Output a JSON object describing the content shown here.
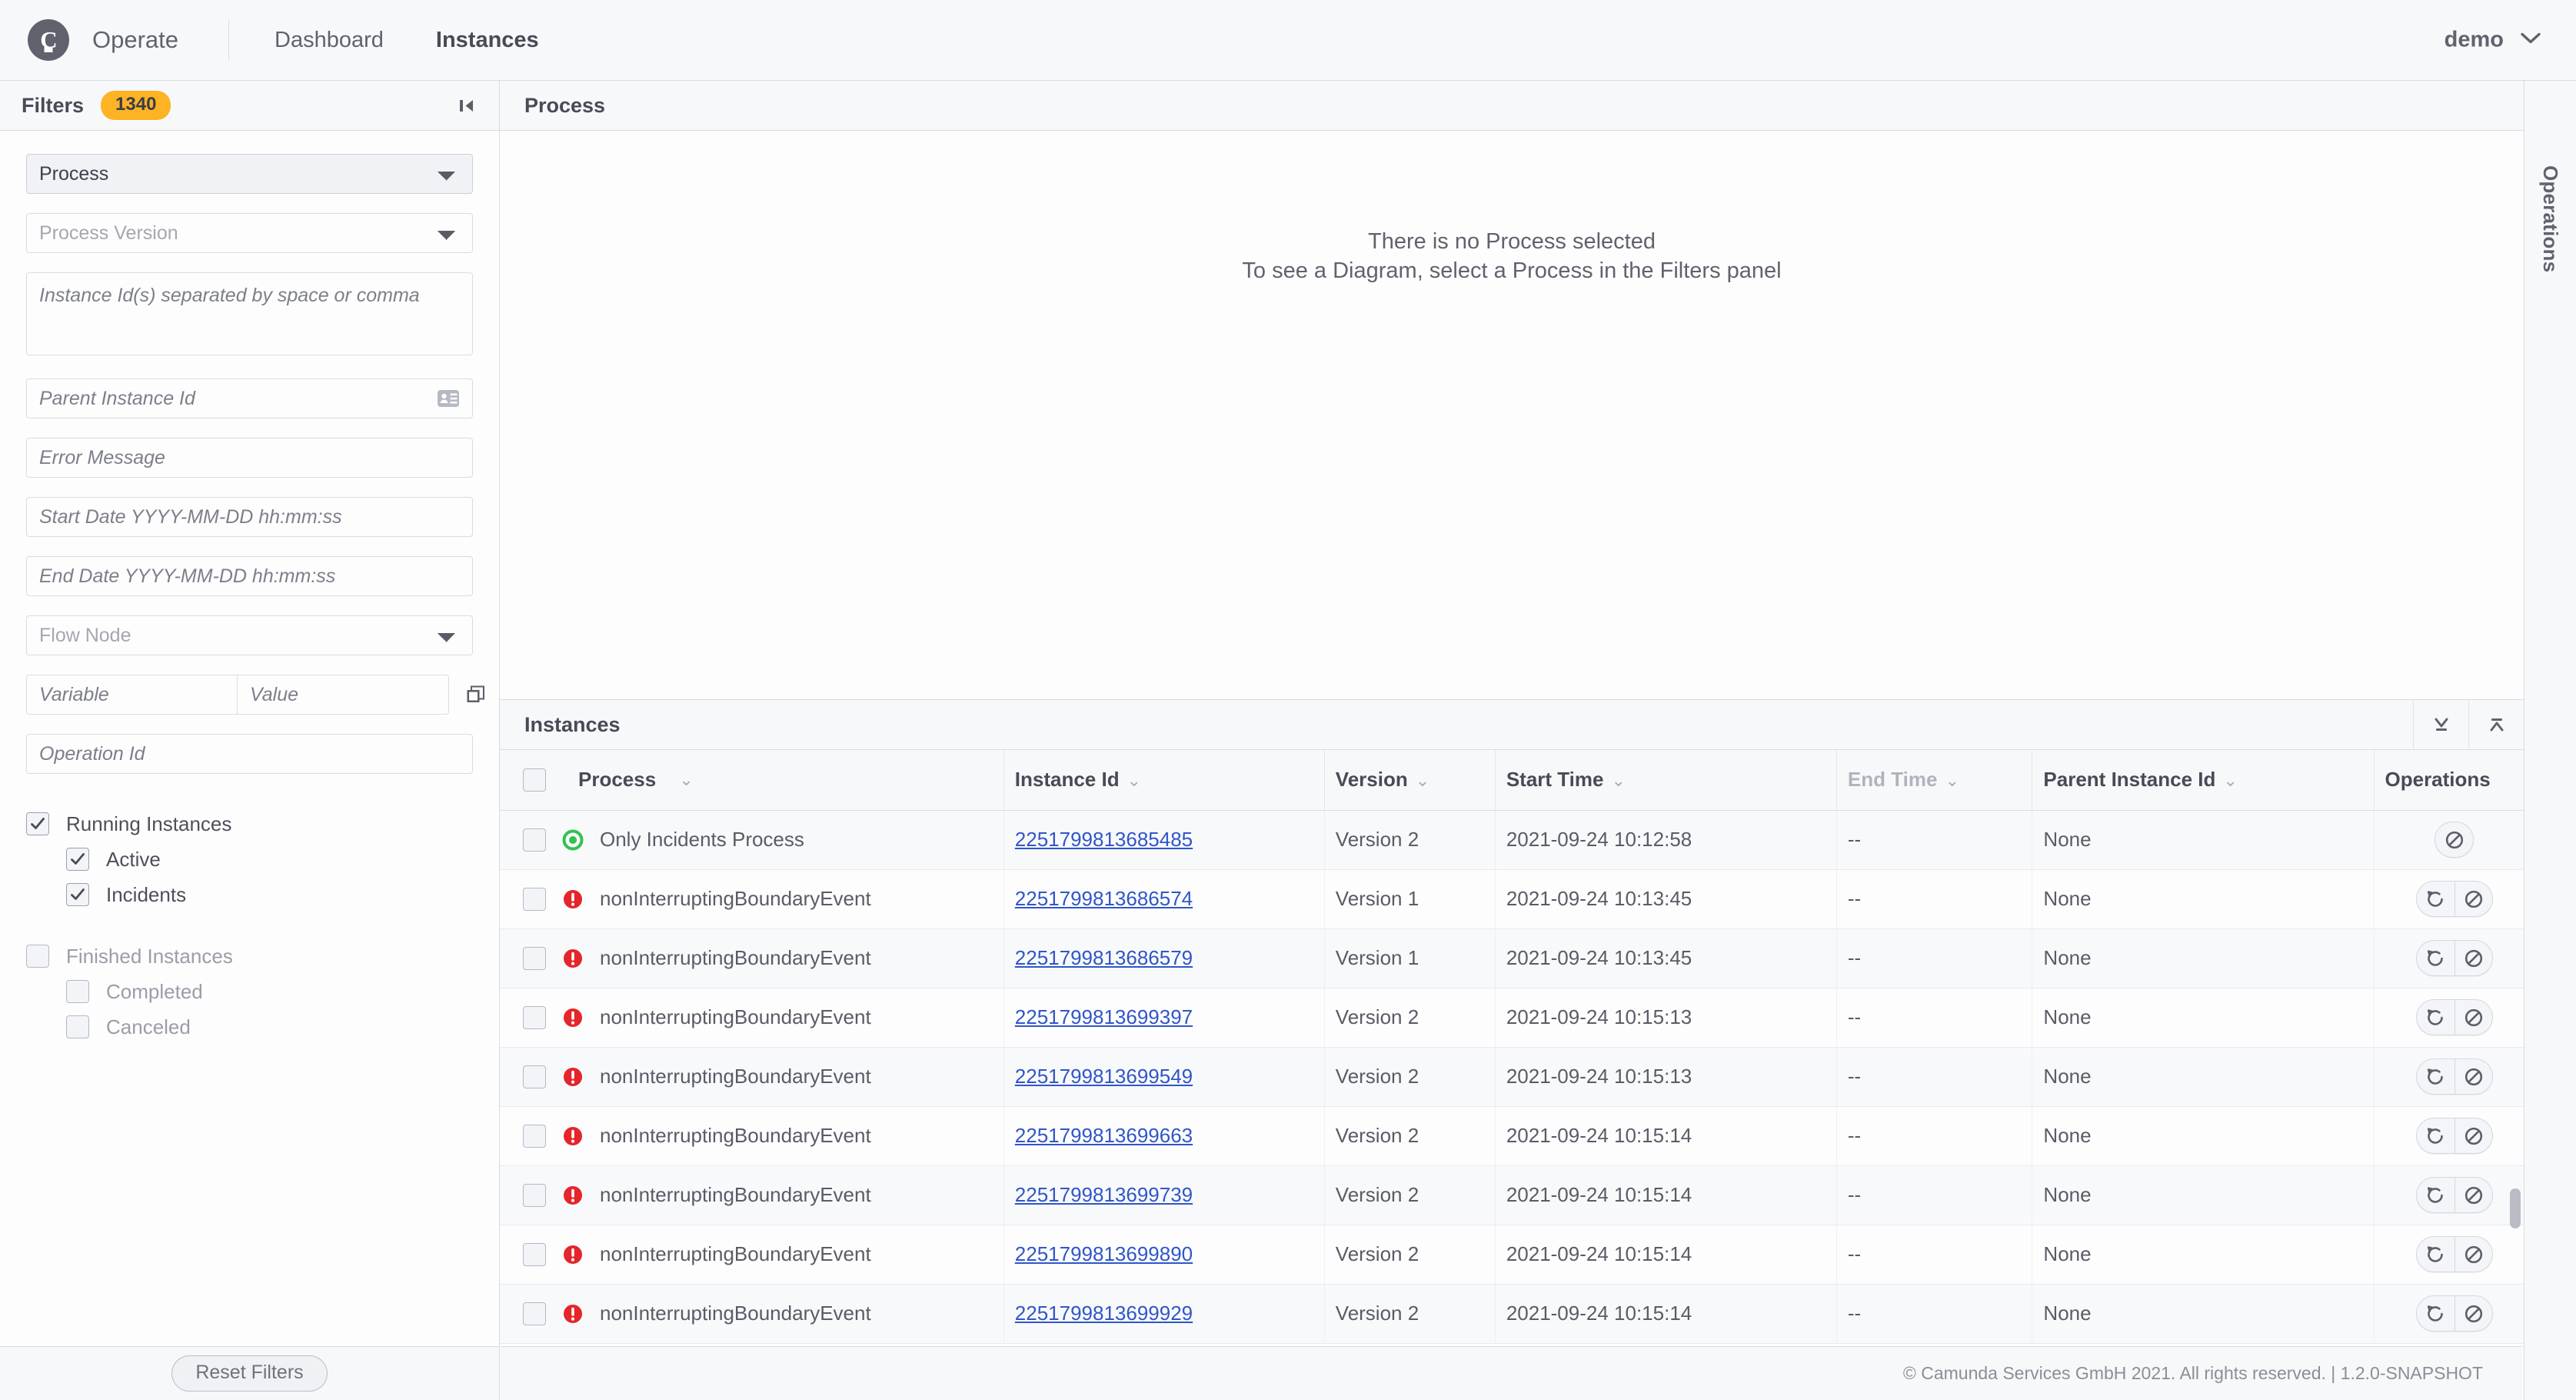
{
  "header": {
    "brand": "Operate",
    "logo_icon": "camunda-logo-icon",
    "nav": [
      {
        "label": "Dashboard",
        "active": false
      },
      {
        "label": "Instances",
        "active": true
      }
    ],
    "user": "demo",
    "user_chevron_icon": "chevron-down-icon"
  },
  "filters": {
    "title": "Filters",
    "count_badge": "1340",
    "collapse_icon": "collapse-left-icon",
    "process_select": {
      "value": "Process",
      "options": [
        "Process"
      ]
    },
    "process_version_select": {
      "placeholder": "Process Version",
      "value": "",
      "options": [
        "Process Version"
      ]
    },
    "instance_ids": {
      "placeholder": "Instance Id(s) separated by space or comma",
      "value": ""
    },
    "parent_instance_id": {
      "placeholder": "Parent Instance Id",
      "value": "",
      "icon": "id-card-icon"
    },
    "error_message": {
      "placeholder": "Error Message",
      "value": ""
    },
    "start_date": {
      "placeholder": "Start Date YYYY-MM-DD hh:mm:ss",
      "value": ""
    },
    "end_date": {
      "placeholder": "End Date YYYY-MM-DD hh:mm:ss",
      "value": ""
    },
    "flow_node_select": {
      "placeholder": "Flow Node",
      "value": "",
      "options": [
        "Flow Node"
      ]
    },
    "variable": {
      "placeholder": "Variable",
      "value": ""
    },
    "variable_value": {
      "placeholder": "Value",
      "value": ""
    },
    "variable_copy_icon": "copy-icon",
    "operation_id": {
      "placeholder": "Operation Id",
      "value": ""
    },
    "checkboxes": [
      {
        "label": "Running Instances",
        "checked": true,
        "indent": false,
        "dim": false
      },
      {
        "label": "Active",
        "checked": true,
        "indent": true,
        "dim": false
      },
      {
        "label": "Incidents",
        "checked": true,
        "indent": true,
        "dim": false
      },
      {
        "label": "Finished Instances",
        "checked": false,
        "indent": false,
        "dim": true
      },
      {
        "label": "Completed",
        "checked": false,
        "indent": true,
        "dim": true
      },
      {
        "label": "Canceled",
        "checked": false,
        "indent": true,
        "dim": true
      }
    ],
    "reset_button": "Reset Filters"
  },
  "process_panel": {
    "title": "Process",
    "empty_line_1": "There is no Process selected",
    "empty_line_2": "To see a Diagram, select a Process in the Filters panel"
  },
  "instances_panel": {
    "title": "Instances",
    "expand_down_icon": "collapse-down-icon",
    "expand_up_icon": "collapse-up-icon",
    "columns": [
      {
        "key": "process",
        "label": "Process",
        "sortable": true,
        "dim": false
      },
      {
        "key": "instance_id",
        "label": "Instance Id",
        "sortable": true,
        "dim": false
      },
      {
        "key": "version",
        "label": "Version",
        "sortable": true,
        "dim": false
      },
      {
        "key": "start_time",
        "label": "Start Time",
        "sortable": true,
        "dim": false
      },
      {
        "key": "end_time",
        "label": "End Time",
        "sortable": true,
        "dim": true
      },
      {
        "key": "parent_instance_id",
        "label": "Parent Instance Id",
        "sortable": true,
        "dim": false
      },
      {
        "key": "operations",
        "label": "Operations",
        "sortable": false,
        "dim": false
      }
    ],
    "select_all_checked": false,
    "rows": [
      {
        "selected": false,
        "status": "active",
        "process": "Only Incidents Process",
        "instance_id": "2251799813685485",
        "version": "Version 2",
        "start_time": "2021-09-24 10:12:58",
        "end_time": "--",
        "parent_instance_id": "None",
        "operations": [
          "cancel"
        ]
      },
      {
        "selected": false,
        "status": "incident",
        "process": "nonInterruptingBoundaryEvent",
        "instance_id": "2251799813686574",
        "version": "Version 1",
        "start_time": "2021-09-24 10:13:45",
        "end_time": "--",
        "parent_instance_id": "None",
        "operations": [
          "retry",
          "cancel"
        ]
      },
      {
        "selected": false,
        "status": "incident",
        "process": "nonInterruptingBoundaryEvent",
        "instance_id": "2251799813686579",
        "version": "Version 1",
        "start_time": "2021-09-24 10:13:45",
        "end_time": "--",
        "parent_instance_id": "None",
        "operations": [
          "retry",
          "cancel"
        ]
      },
      {
        "selected": false,
        "status": "incident",
        "process": "nonInterruptingBoundaryEvent",
        "instance_id": "2251799813699397",
        "version": "Version 2",
        "start_time": "2021-09-24 10:15:13",
        "end_time": "--",
        "parent_instance_id": "None",
        "operations": [
          "retry",
          "cancel"
        ]
      },
      {
        "selected": false,
        "status": "incident",
        "process": "nonInterruptingBoundaryEvent",
        "instance_id": "2251799813699549",
        "version": "Version 2",
        "start_time": "2021-09-24 10:15:13",
        "end_time": "--",
        "parent_instance_id": "None",
        "operations": [
          "retry",
          "cancel"
        ]
      },
      {
        "selected": false,
        "status": "incident",
        "process": "nonInterruptingBoundaryEvent",
        "instance_id": "2251799813699663",
        "version": "Version 2",
        "start_time": "2021-09-24 10:15:14",
        "end_time": "--",
        "parent_instance_id": "None",
        "operations": [
          "retry",
          "cancel"
        ]
      },
      {
        "selected": false,
        "status": "incident",
        "process": "nonInterruptingBoundaryEvent",
        "instance_id": "2251799813699739",
        "version": "Version 2",
        "start_time": "2021-09-24 10:15:14",
        "end_time": "--",
        "parent_instance_id": "None",
        "operations": [
          "retry",
          "cancel"
        ]
      },
      {
        "selected": false,
        "status": "incident",
        "process": "nonInterruptingBoundaryEvent",
        "instance_id": "2251799813699890",
        "version": "Version 2",
        "start_time": "2021-09-24 10:15:14",
        "end_time": "--",
        "parent_instance_id": "None",
        "operations": [
          "retry",
          "cancel"
        ]
      },
      {
        "selected": false,
        "status": "incident",
        "process": "nonInterruptingBoundaryEvent",
        "instance_id": "2251799813699929",
        "version": "Version 2",
        "start_time": "2021-09-24 10:15:14",
        "end_time": "--",
        "parent_instance_id": "None",
        "operations": [
          "retry",
          "cancel"
        ]
      }
    ]
  },
  "operations_rail": {
    "label": "Operations"
  },
  "footer": {
    "text": "© Camunda Services GmbH 2021. All rights reserved. | 1.2.0-SNAPSHOT"
  },
  "colors": {
    "accent_link": "#3056c7",
    "badge": "#fdb324",
    "status_active": "#34c14d",
    "status_incident": "#e4252a",
    "panel_bg": "#f7f8fa",
    "border": "#d8dce3"
  }
}
